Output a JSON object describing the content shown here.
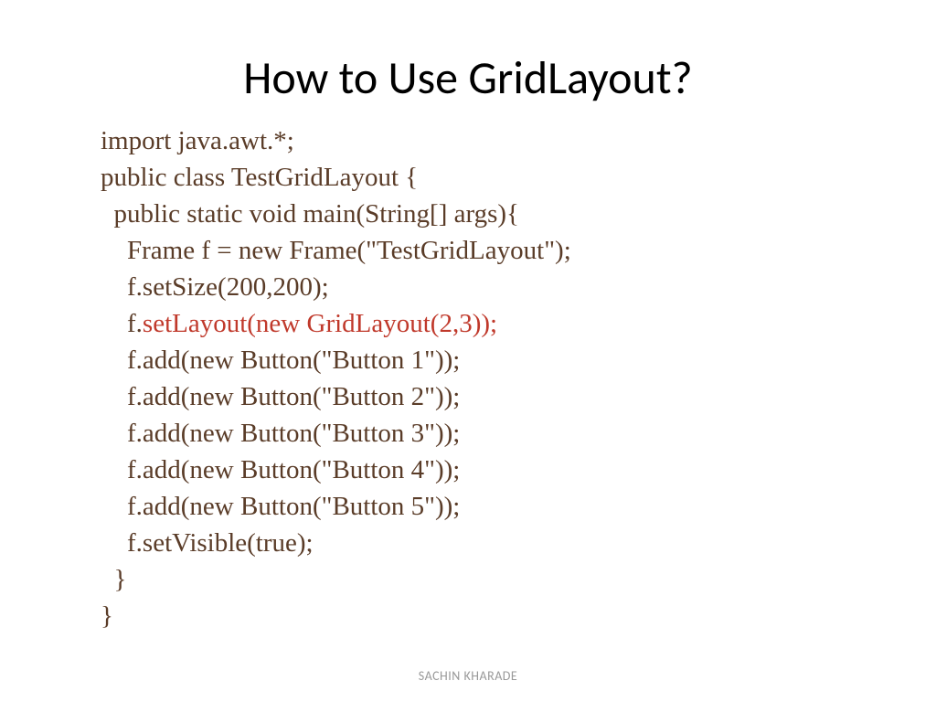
{
  "title": "How to Use GridLayout?",
  "code": {
    "line1": "import java.awt.*;",
    "line2": "public class TestGridLayout {",
    "line3": "  public static void main(String[] args){",
    "line4": "    Frame f = new Frame(\"TestGridLayout\");",
    "line5": "    f.setSize(200,200);",
    "line6a": "    f.",
    "line6b": "setLayout(new GridLayout(2,3));",
    "line7": "    f.add(new Button(\"Button 1\"));",
    "line8": "    f.add(new Button(\"Button 2\"));",
    "line9": "    f.add(new Button(\"Button 3\"));",
    "line10": "    f.add(new Button(\"Button 4\"));",
    "line11": "    f.add(new Button(\"Button 5\"));",
    "line12": "",
    "line13": "    f.setVisible(true);",
    "line14": "  }",
    "line15": "}"
  },
  "footer": "SACHIN KHARADE"
}
